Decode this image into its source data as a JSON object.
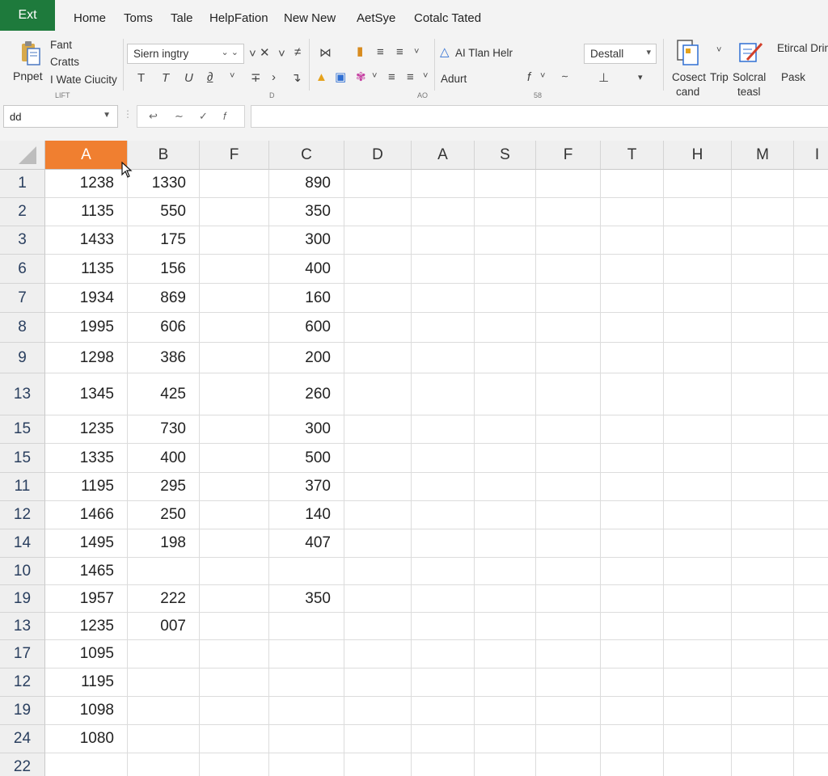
{
  "app": {
    "label": "Ext",
    "color": "#1e7a3c"
  },
  "tabs": [
    "Home",
    "Toms",
    "Tale",
    "HelpFation",
    "New New",
    "AetSye",
    "Cotalc Tated"
  ],
  "ribbon": {
    "clipboard": {
      "paste_label": "Pnpet",
      "font_label": "Fant",
      "crafts_label": "Cratts",
      "quality_label": "I Wate Ciucity",
      "group_caption": "LIFT"
    },
    "font": {
      "font_name": "Siern ingtry",
      "group_caption": "D"
    },
    "ai": {
      "help_label": "AI Tlan Helr",
      "adjust_label": "Adurt",
      "group_caption": "AO"
    },
    "number": {
      "format_value": "Destall",
      "group_caption": "58"
    },
    "commands": {
      "item1_line1": "Cosect",
      "item1_line2": "cand",
      "item2": "Trip",
      "item3_line1": "Solcral",
      "item3_line2": "teasl",
      "item4_line1": "Etircal Drin",
      "item4_line2": "Pask"
    }
  },
  "formula_bar": {
    "name_box": "dd",
    "formula": ""
  },
  "columns": [
    "A",
    "B",
    "F",
    "C",
    "D",
    "A",
    "S",
    "F",
    "T",
    "H",
    "M",
    "I"
  ],
  "selected_column": "A",
  "selected_color": "#f07f30",
  "rows": [
    {
      "label": "1",
      "a": "1238",
      "b": "1330",
      "c": "890"
    },
    {
      "label": "2",
      "a": "1135",
      "b": "550",
      "c": "350"
    },
    {
      "label": "3",
      "a": "1433",
      "b": "175",
      "c": "300"
    },
    {
      "label": "6",
      "a": "1135",
      "b": "156",
      "c": "400"
    },
    {
      "label": "7",
      "a": "1934",
      "b": "869",
      "c": "160"
    },
    {
      "label": "8",
      "a": "1995",
      "b": "606",
      "c": "600"
    },
    {
      "label": "9",
      "a": "1298",
      "b": "386",
      "c": "200"
    },
    {
      "label": "13",
      "a": "1345",
      "b": "425",
      "c": "260"
    },
    {
      "label": "15",
      "a": "1235",
      "b": "730",
      "c": "300"
    },
    {
      "label": "15",
      "a": "1335",
      "b": "400",
      "c": "500"
    },
    {
      "label": "11",
      "a": "1195",
      "b": "295",
      "c": "370"
    },
    {
      "label": "12",
      "a": "1466",
      "b": "250",
      "c": "140"
    },
    {
      "label": "14",
      "a": "1495",
      "b": "198",
      "c": "407"
    },
    {
      "label": "10",
      "a": "1465",
      "b": "",
      "c": ""
    },
    {
      "label": "19",
      "a": "1957",
      "b": "222",
      "c": "350"
    },
    {
      "label": "13",
      "a": "1235",
      "b": "007",
      "c": ""
    },
    {
      "label": "17",
      "a": "1095",
      "b": "",
      "c": ""
    },
    {
      "label": "12",
      "a": "1195",
      "b": "",
      "c": ""
    },
    {
      "label": "19",
      "a": "1098",
      "b": "",
      "c": ""
    },
    {
      "label": "24",
      "a": "1080",
      "b": "",
      "c": ""
    },
    {
      "label": "22",
      "a": "",
      "b": "",
      "c": ""
    }
  ]
}
